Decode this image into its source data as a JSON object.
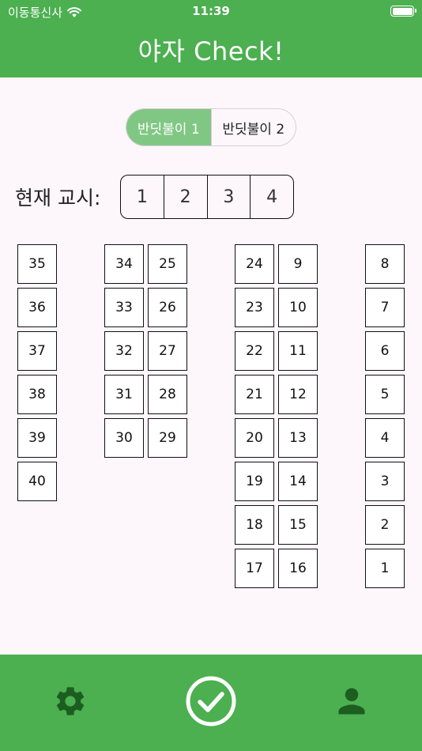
{
  "status_bar": {
    "carrier": "이동통신사",
    "time": "11:39",
    "battery_level": 1.0
  },
  "header": {
    "title": "야자 Check!"
  },
  "segmented": {
    "options": [
      "반딧불이 1",
      "반딧불이 2"
    ],
    "selected": "반딧불이 1"
  },
  "period_selector": {
    "label": "현재 교시:",
    "options": [
      "1",
      "2",
      "3",
      "4"
    ]
  },
  "seats": {
    "col1": [
      "35",
      "36",
      "37",
      "38",
      "39",
      "40"
    ],
    "col2": [
      "34",
      "33",
      "32",
      "31",
      "30"
    ],
    "col3": [
      "25",
      "26",
      "27",
      "28",
      "29"
    ],
    "col4": [
      "24",
      "23",
      "22",
      "21",
      "20",
      "19",
      "18",
      "17"
    ],
    "col5": [
      "9",
      "10",
      "11",
      "12",
      "13",
      "14",
      "15",
      "16"
    ],
    "col6": [
      "8",
      "7",
      "6",
      "5",
      "4",
      "3",
      "2",
      "1"
    ]
  },
  "bottom_nav": {
    "items": [
      "gear-icon",
      "check-circle-icon",
      "person-icon"
    ],
    "icon_color": "#1b5e20",
    "center_icon_color": "#ffffff"
  },
  "colors": {
    "primary": "#4caf50",
    "selected_segment": "#81c784",
    "background": "#fdf6fb"
  }
}
